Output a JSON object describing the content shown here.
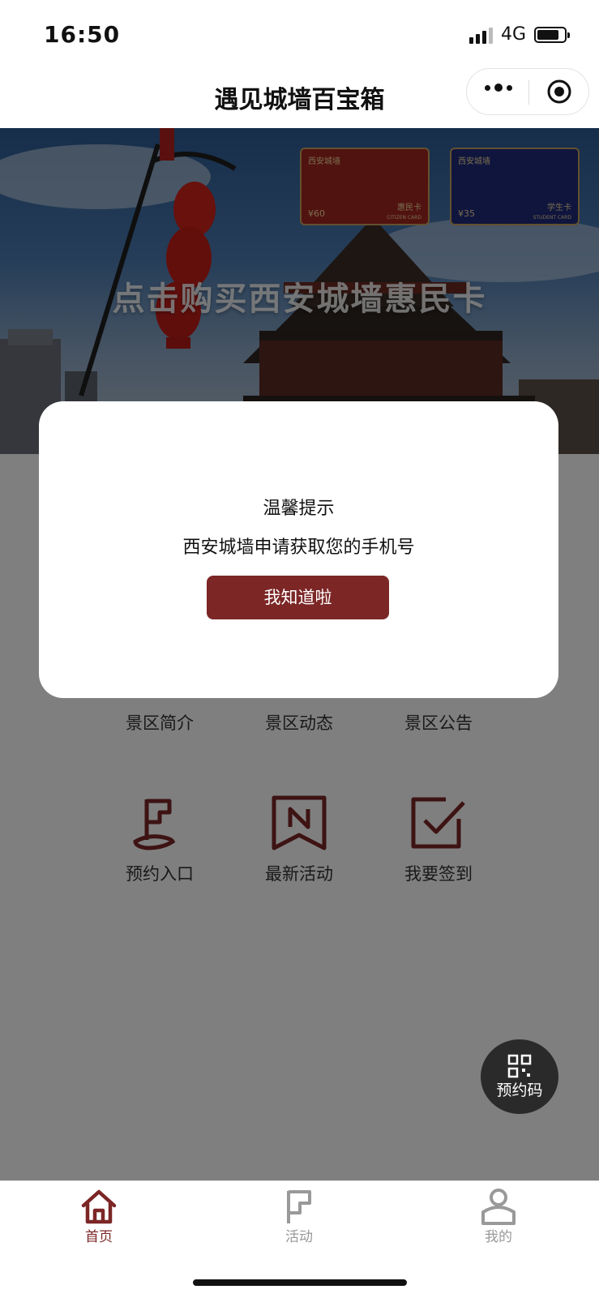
{
  "status_bar": {
    "time": "16:50",
    "network": "4G"
  },
  "nav": {
    "title": "遇见城墙百宝箱"
  },
  "banner": {
    "caption": "点击购买西安城墙惠民卡",
    "cards": [
      {
        "brand": "西安城墙",
        "price": "¥60",
        "name": "惠民卡",
        "sub": "CITIZEN CARD",
        "color": "#a3261f"
      },
      {
        "brand": "西安城墙",
        "price": "¥35",
        "name": "学生卡",
        "sub": "STUDENT CARD",
        "color": "#1e2a7a"
      }
    ]
  },
  "menu": {
    "row1": [
      "景区简介",
      "景区动态",
      "景区公告"
    ],
    "row2": [
      {
        "label": "预约入口",
        "icon": "flag-pin-icon"
      },
      {
        "label": "最新活动",
        "icon": "news-bookmark-icon"
      },
      {
        "label": "我要签到",
        "icon": "checkbox-icon"
      }
    ]
  },
  "fab": {
    "label": "预约码",
    "icon": "qr-code-icon"
  },
  "modal": {
    "title": "温馨提示",
    "message": "西安城墙申请获取您的手机号",
    "button": "我知道啦"
  },
  "tabbar": {
    "items": [
      {
        "label": "首页",
        "icon": "home-icon",
        "active": true
      },
      {
        "label": "活动",
        "icon": "flag-icon",
        "active": false
      },
      {
        "label": "我的",
        "icon": "user-icon",
        "active": false
      }
    ]
  },
  "colors": {
    "brand": "#7c2626",
    "overlay": "rgba(0,0,0,0.5)",
    "tab_inactive": "#999999"
  }
}
